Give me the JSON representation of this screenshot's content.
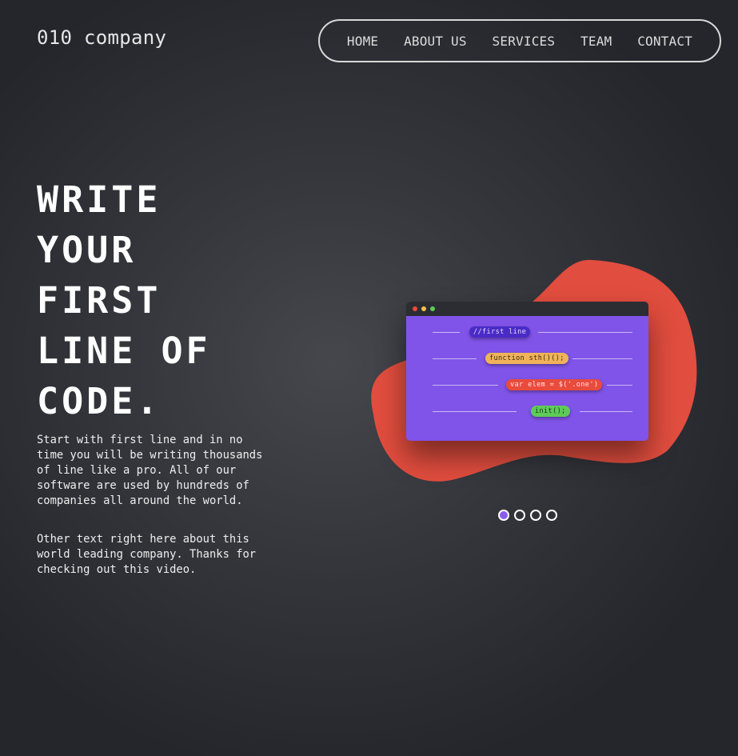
{
  "brand": {
    "logo_text": "010 company"
  },
  "nav": {
    "items": [
      {
        "label": "HOME"
      },
      {
        "label": "ABOUT US"
      },
      {
        "label": "SERVICES"
      },
      {
        "label": "TEAM"
      },
      {
        "label": "CONTACT"
      }
    ]
  },
  "hero": {
    "headline_lines": [
      "WRITE",
      "YOUR",
      "FIRST",
      "LINE OF",
      "CODE."
    ],
    "paragraph1": "Start with first line and in no time you will be writing thousands of line like a pro. All of our software are used by hundreds of companies all around the world.",
    "paragraph2": "Other text right here about this world leading company. Thanks for checking out this video."
  },
  "illustration": {
    "window_dots": [
      {
        "color": "#e94b3c",
        "icon": "close-dot-icon"
      },
      {
        "color": "#f2c14e",
        "icon": "minimize-dot-icon"
      },
      {
        "color": "#5ecb58",
        "icon": "maximize-dot-icon"
      }
    ],
    "code_lines": [
      {
        "text": "//first line",
        "bg": "#4a2bc7",
        "fg": "#e6dcff"
      },
      {
        "text": "function sth()();",
        "bg": "#f0b35a",
        "fg": "#3a2a10"
      },
      {
        "text": "var elem = $('.one')",
        "bg": "#e94b3c",
        "fg": "#ffe6e2"
      },
      {
        "text": "init();",
        "bg": "#5ecb58",
        "fg": "#15361a"
      }
    ],
    "blob_color": "#e14d3e",
    "window_color": "#8054e8"
  },
  "slider": {
    "count": 4,
    "active_index": 0,
    "active_color": "#8a5cf0"
  }
}
